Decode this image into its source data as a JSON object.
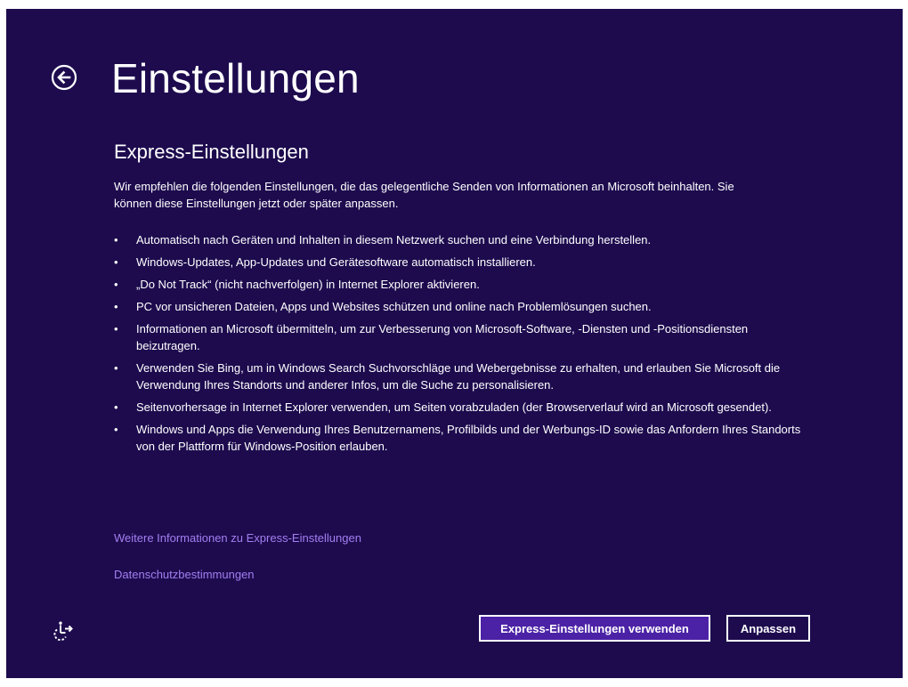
{
  "page": {
    "title": "Einstellungen",
    "subtitle": "Express-Einstellungen",
    "intro": "Wir empfehlen die folgenden Einstellungen, die das gelegentliche Senden von Informationen an Microsoft beinhalten. Sie können diese Einstellungen jetzt oder später anpassen."
  },
  "bullets": [
    "Automatisch nach Geräten und Inhalten in diesem Netzwerk suchen und eine Verbindung herstellen.",
    "Windows-Updates, App-Updates und Gerätesoftware automatisch installieren.",
    "„Do Not Track“ (nicht nachverfolgen) in Internet Explorer aktivieren.",
    "PC vor unsicheren Dateien, Apps und Websites schützen und online nach Problemlösungen suchen.",
    "Informationen an Microsoft übermitteln, um zur Verbesserung von Microsoft-Software, -Diensten und -Positionsdiensten beizutragen.",
    "Verwenden Sie Bing, um in Windows Search Suchvorschläge und Webergebnisse zu erhalten, und erlauben Sie Microsoft die Verwendung Ihres Standorts und anderer Infos, um die Suche zu personalisieren.",
    "Seitenvorhersage in Internet Explorer verwenden, um Seiten vorabzuladen (der Browserverlauf wird an Microsoft gesendet).",
    "Windows und Apps die Verwendung Ihres Benutzernamens, Profilbilds und der Werbungs-ID sowie das Anfordern Ihres Standorts von der Plattform für Windows-Position erlauben."
  ],
  "links": {
    "more_info": "Weitere Informationen zu Express-Einstellungen",
    "privacy": "Datenschutzbestimmungen"
  },
  "buttons": {
    "express": "Express-Einstellungen verwenden",
    "customize": "Anpassen"
  },
  "icons": {
    "back": "back-arrow-icon",
    "accessibility": "ease-of-access-icon"
  },
  "colors": {
    "background": "#1d0b4e",
    "primary_button": "#4b22a6",
    "link": "#a47ef0",
    "text": "#ffffff"
  }
}
